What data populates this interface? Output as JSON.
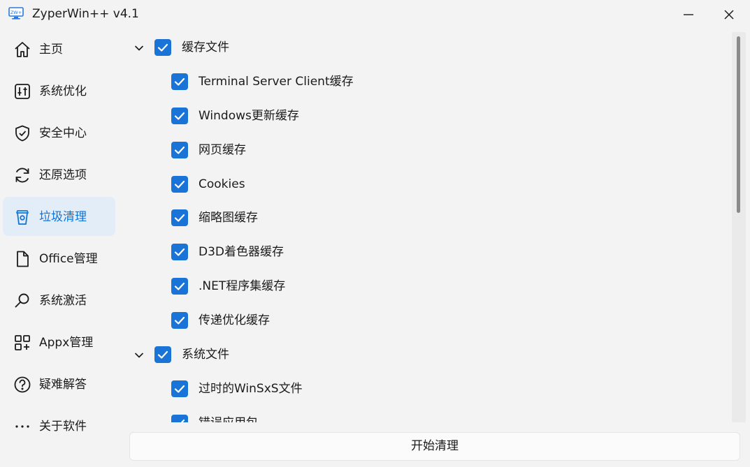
{
  "window": {
    "title": "ZyperWin++ v4.1",
    "icon_text": "ZW+"
  },
  "sidebar": {
    "items": [
      {
        "label": "主页",
        "icon": "home-icon",
        "active": false
      },
      {
        "label": "系统优化",
        "icon": "sliders-icon",
        "active": false
      },
      {
        "label": "安全中心",
        "icon": "shield-icon",
        "active": false
      },
      {
        "label": "还原选项",
        "icon": "restore-icon",
        "active": false
      },
      {
        "label": "垃圾清理",
        "icon": "trash-cup-icon",
        "active": true
      },
      {
        "label": "Office管理",
        "icon": "document-icon",
        "active": false
      },
      {
        "label": "系统激活",
        "icon": "key-icon",
        "active": false
      },
      {
        "label": "Appx管理",
        "icon": "apps-grid-icon",
        "active": false
      },
      {
        "label": "疑难解答",
        "icon": "help-icon",
        "active": false
      },
      {
        "label": "关于软件",
        "icon": "more-icon",
        "active": false
      }
    ]
  },
  "tree": {
    "groups": [
      {
        "label": "缓存文件",
        "expanded": true,
        "checked": true,
        "items": [
          {
            "label": "Terminal Server Client缓存",
            "checked": true
          },
          {
            "label": "Windows更新缓存",
            "checked": true
          },
          {
            "label": "网页缓存",
            "checked": true
          },
          {
            "label": "Cookies",
            "checked": true
          },
          {
            "label": "缩略图缓存",
            "checked": true
          },
          {
            "label": "D3D着色器缓存",
            "checked": true
          },
          {
            "label": ".NET程序集缓存",
            "checked": true
          },
          {
            "label": "传递优化缓存",
            "checked": true
          }
        ]
      },
      {
        "label": "系统文件",
        "expanded": true,
        "checked": true,
        "items": [
          {
            "label": "过时的WinSxS文件",
            "checked": true
          },
          {
            "label": "错误应用包",
            "checked": true
          }
        ]
      }
    ]
  },
  "footer": {
    "start_label": "开始清理"
  },
  "colors": {
    "accent": "#1a74d8",
    "active_nav_bg": "#e3edf7",
    "active_nav_text": "#1474d4",
    "window_bg": "#f3f3f3"
  }
}
